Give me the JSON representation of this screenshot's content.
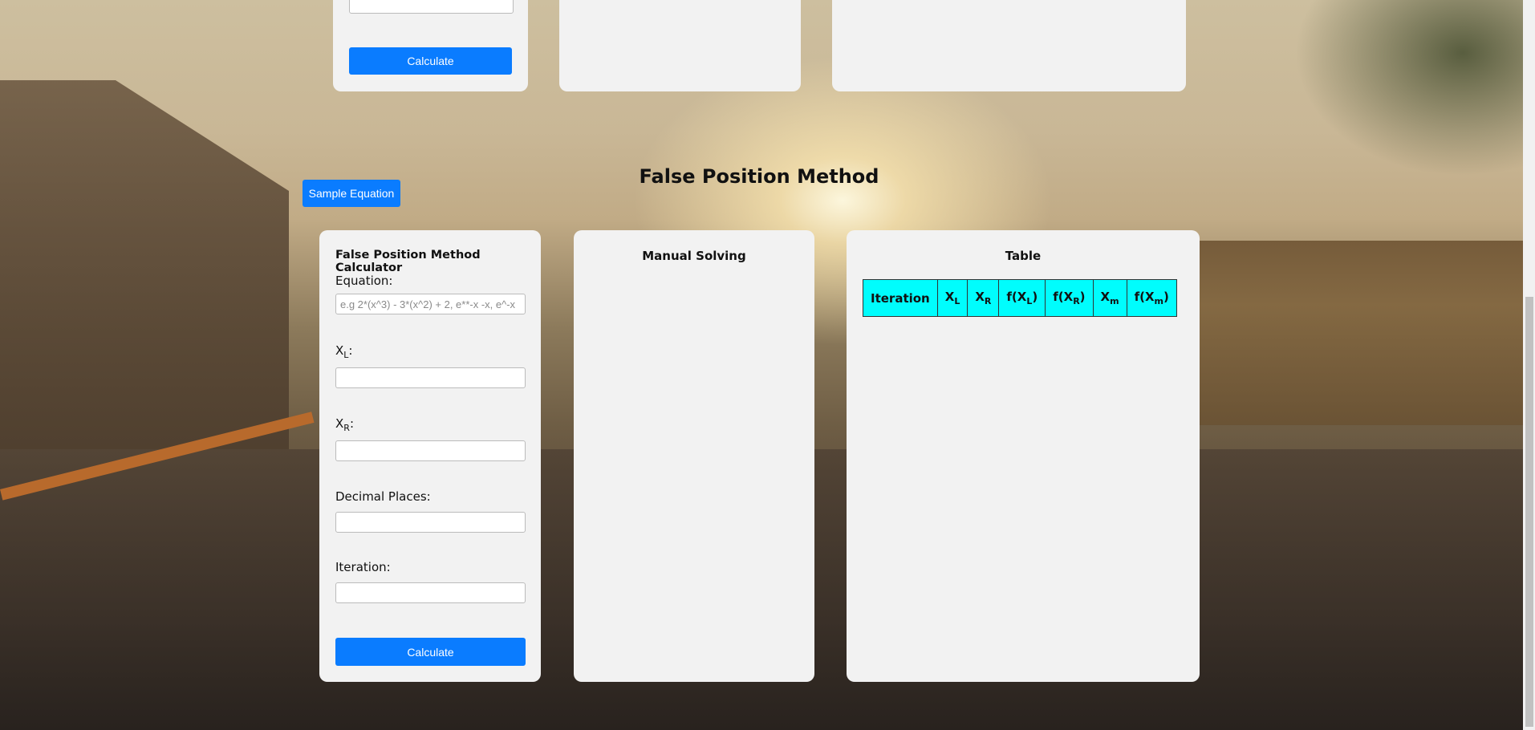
{
  "previous_section": {
    "calculate_label": "Calculate"
  },
  "section_title": "False Position Method",
  "sample_equation_label": "Sample Equation",
  "calculator": {
    "heading": "False Position Method Calculator",
    "equation_label": "Equation:",
    "equation_placeholder": "e.g 2*(x^3) - 3*(x^2) + 2, e**-x -x, e^-x",
    "xl_label_main": "X",
    "xl_label_sub": "L",
    "xr_label_main": "X",
    "xr_label_sub": "R",
    "colon": ":",
    "decimal_label": "Decimal Places:",
    "iteration_label": "Iteration:",
    "calculate_label": "Calculate"
  },
  "manual": {
    "heading": "Manual Solving"
  },
  "table": {
    "heading": "Table",
    "columns": [
      {
        "pre": "Iteration",
        "sub": "",
        "post": ""
      },
      {
        "pre": "X",
        "sub": "L",
        "post": ""
      },
      {
        "pre": "X",
        "sub": "R",
        "post": ""
      },
      {
        "pre": "f(X",
        "sub": "L",
        "post": ")"
      },
      {
        "pre": "f(X",
        "sub": "R",
        "post": ")"
      },
      {
        "pre": "X",
        "sub": "m",
        "post": ""
      },
      {
        "pre": "f(X",
        "sub": "m",
        "post": ")"
      }
    ],
    "header_color": "#00fdfd"
  },
  "colors": {
    "button": "#0a7cff",
    "panel": "#f2f2f2"
  }
}
